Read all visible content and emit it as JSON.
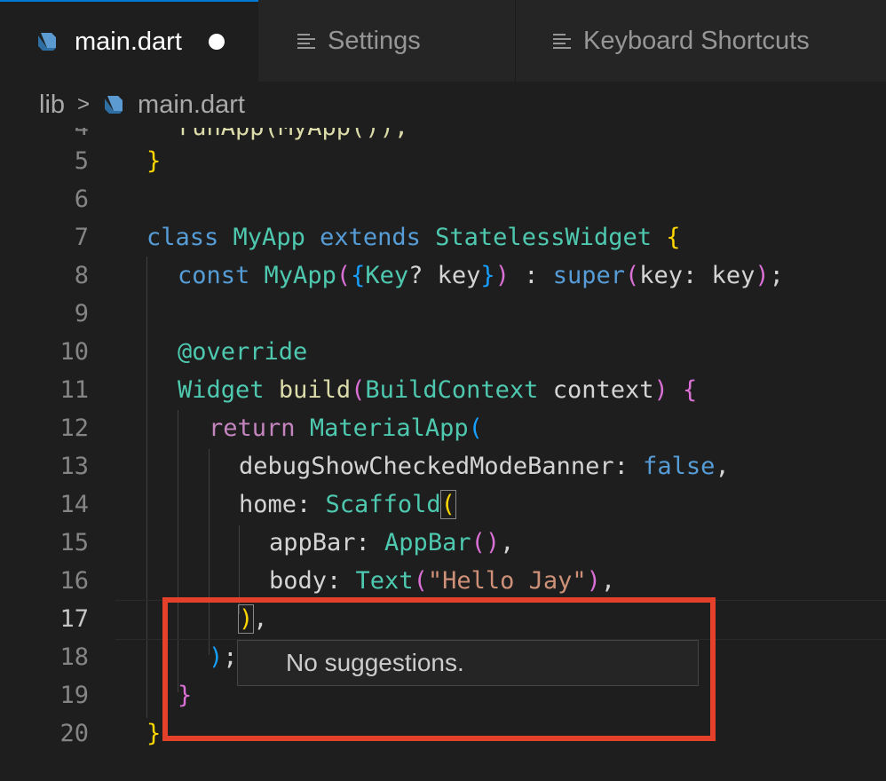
{
  "tabs": [
    {
      "label": "main.dart",
      "active": true,
      "dirty": true,
      "icon": "dart-icon"
    },
    {
      "label": "Settings",
      "active": false,
      "icon": "menu-icon"
    },
    {
      "label": "Keyboard Shortcuts",
      "active": false,
      "icon": "menu-icon"
    }
  ],
  "breadcrumb": {
    "folder": "lib",
    "separator": ">",
    "file": "main.dart"
  },
  "editor": {
    "partial_line_text": "runApp(MyApp());",
    "lines": [
      {
        "num": "5",
        "text": "}"
      },
      {
        "num": "6",
        "text": ""
      },
      {
        "num": "7",
        "text": "class MyApp extends StatelessWidget {"
      },
      {
        "num": "8",
        "text": "const MyApp({Key? key}) : super(key: key);"
      },
      {
        "num": "9",
        "text": ""
      },
      {
        "num": "10",
        "text": "@override"
      },
      {
        "num": "11",
        "text": "Widget build(BuildContext context) {"
      },
      {
        "num": "12",
        "text": "return MaterialApp("
      },
      {
        "num": "13",
        "text": "debugShowCheckedModeBanner: false,"
      },
      {
        "num": "14",
        "text": "home: Scaffold("
      },
      {
        "num": "15",
        "text": "appBar: AppBar(),"
      },
      {
        "num": "16",
        "text": "body: Text(\"Hello Jay\"),"
      },
      {
        "num": "17",
        "text": "),"
      },
      {
        "num": "18",
        "text": ");"
      },
      {
        "num": "19",
        "text": "}"
      },
      {
        "num": "20",
        "text": "}"
      }
    ],
    "current_line": "17"
  },
  "suggest_widget": {
    "message": "No suggestions."
  },
  "colors": {
    "highlight_box": "#e5402a",
    "tab_accent": "#0078d4"
  }
}
